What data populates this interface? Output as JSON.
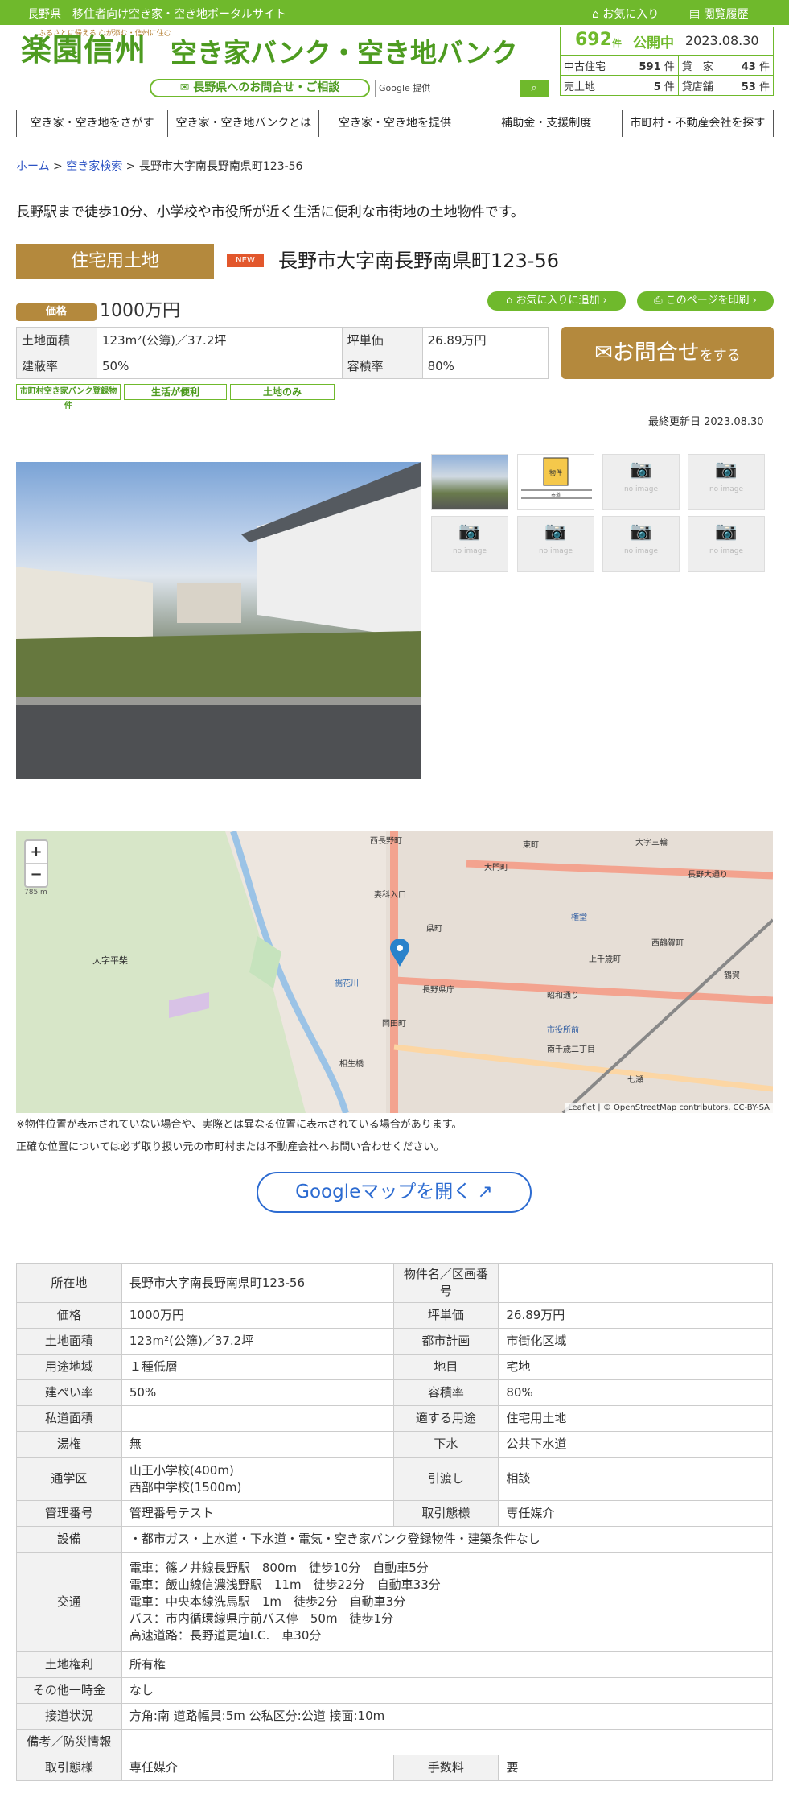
{
  "topbar": {
    "tagline": "長野県　移住者向け空き家・空き地ポータルサイト",
    "favorites": "お気に入り",
    "history": "閲覧履歴"
  },
  "logo": {
    "small": "ふるさとに帰える 心が添む・信州に住む",
    "brand": "楽園信州",
    "bank": "空き家バンク・空き地バンク"
  },
  "contact_pill": "長野県へのお問合せ・ご相談",
  "search": {
    "placeholder": "Google 提供"
  },
  "stats": {
    "count": "692",
    "count_unit": "件",
    "status": "公開中",
    "date": "2023.08.30",
    "rows": [
      {
        "l1": "中古住宅",
        "v1": "591",
        "u1": "件",
        "l2": "貸　家",
        "v2": "43",
        "u2": "件"
      },
      {
        "l1": "売土地",
        "v1": "5",
        "u1": "件",
        "l2": "貸店舗",
        "v2": "53",
        "u2": "件"
      }
    ]
  },
  "nav": [
    "空き家・空き地をさがす",
    "空き家・空き地バンクとは",
    "空き家・空き地を提供",
    "補助金・支援制度",
    "市町村・不動産会社を探す"
  ],
  "breadcrumb": {
    "home": "ホーム",
    "search": "空き家検索",
    "current": "長野市大字南長野南県町123-56"
  },
  "lead": "長野駅まで徒歩10分、小学校や市役所が近く生活に便利な市街地の土地物件です。",
  "property": {
    "type": "住宅用土地",
    "new": "NEW",
    "address": "長野市大字南長野南県町123-56",
    "price_label": "価格",
    "price": "1000万円",
    "add_fav": "お気に入りに追加",
    "print": "このページを印刷",
    "summary": [
      {
        "k1": "土地面積",
        "v1": "123m²(公簿)／37.2坪",
        "k2": "坪単価",
        "v2": "26.89万円"
      },
      {
        "k1": "建蔽率",
        "v1": "50%",
        "k2": "容積率",
        "v2": "80%"
      }
    ],
    "inquiry_main": "お問合せ",
    "inquiry_sub": "をする",
    "chips": [
      "市町村空き家バンク登録物件",
      "生活が便利",
      "土地のみ"
    ],
    "updated": "最終更新日 2023.08.30"
  },
  "thumbs": {
    "no_image": "no image",
    "plan_label": "物件",
    "plan_road": "市道"
  },
  "map": {
    "zoom_in": "+",
    "zoom_out": "−",
    "scale": "785 m",
    "labels": [
      "西長野町",
      "大門町",
      "大字三輪",
      "東町",
      "妻科入口",
      "県町",
      "権堂",
      "上千歳町",
      "西鶴賀町",
      "長野大通り",
      "昭和通り",
      "市役所前",
      "岡田町",
      "長野県庁",
      "鶴賀",
      "大字平柴",
      "裾花川",
      "相生橋",
      "南千歳二丁目",
      "七瀬"
    ],
    "attribution": "Leaflet | © OpenStreetMap contributors, CC-BY-SA",
    "note1": "※物件位置が表示されていない場合や、実際とは異なる位置に表示されている場合があります。",
    "note2": "正確な位置については必ず取り扱い元の市町村または不動産会社へお問い合わせください。",
    "google_btn": "Googleマップを開く"
  },
  "details": {
    "rows4": [
      [
        "所在地",
        "長野市大字南長野南県町123-56",
        "物件名／区画番号",
        ""
      ],
      [
        "価格",
        "1000万円",
        "坪単価",
        "26.89万円"
      ],
      [
        "土地面積",
        "123m²(公簿)／37.2坪",
        "都市計画",
        "市街化区域"
      ],
      [
        "用途地域",
        "１種低層",
        "地目",
        "宅地"
      ],
      [
        "建ぺい率",
        "50%",
        "容積率",
        "80%"
      ],
      [
        "私道面積",
        "",
        "適する用途",
        "住宅用土地"
      ],
      [
        "湯権",
        "無",
        "下水",
        "公共下水道"
      ]
    ],
    "school": {
      "k": "通学区",
      "v1": "山王小学校(400m)",
      "v2": "西部中学校(1500m)",
      "k2": "引渡し",
      "v3": "相談"
    },
    "mgmt": [
      "管理番号",
      "管理番号テスト",
      "取引態様",
      "専任媒介"
    ],
    "equip": {
      "k": "設備",
      "v": "・都市ガス・上水道・下水道・電気・空き家バンク登録物件・建築条件なし"
    },
    "traffic": {
      "k": "交通",
      "lines": [
        "電車：篠ノ井線長野駅　800m　徒歩10分　自動車5分",
        "電車：飯山線信濃浅野駅　11m　徒歩22分　自動車33分",
        "電車：中央本線洗馬駅　1m　徒歩2分　自動車3分",
        "バス：市内循環線県庁前バス停　50m　徒歩1分",
        "高速道路：長野道更埴I.C.　車30分"
      ]
    },
    "rows2": [
      [
        "土地権利",
        "所有権"
      ],
      [
        "その他一時金",
        "なし"
      ],
      [
        "接道状況",
        "方角:南 道路幅員:5m 公私区分:公道 接面:10m"
      ],
      [
        "備考／防災情報",
        ""
      ]
    ],
    "last": [
      "取引態様",
      "専任媒介",
      "手数料",
      "要"
    ]
  }
}
